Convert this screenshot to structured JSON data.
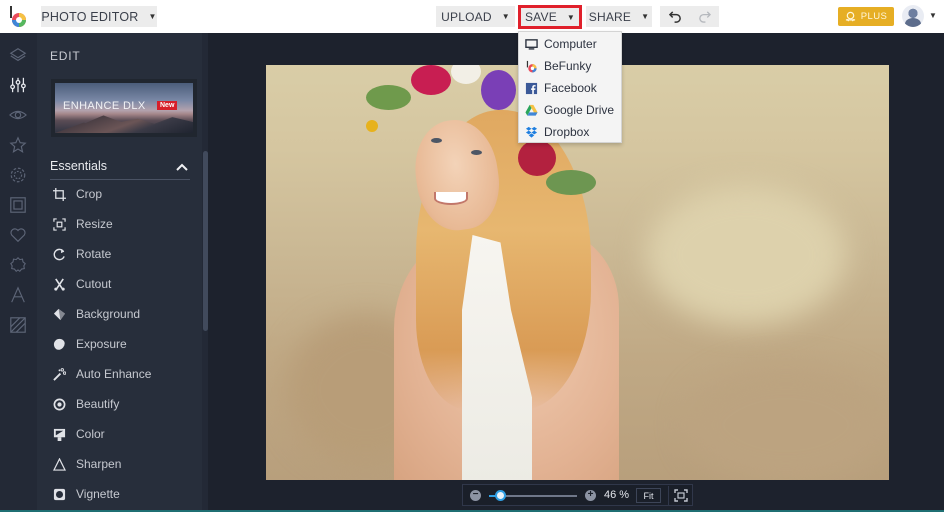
{
  "topbar": {
    "app_menu_label": "PHOTO EDITOR",
    "upload_label": "UPLOAD",
    "save_label": "SAVE",
    "share_label": "SHARE",
    "plus_label": "PLUS",
    "colors": {
      "save_highlight": "#e0202b",
      "plus_bg": "#e6ae24"
    }
  },
  "save_menu": {
    "items": [
      {
        "label": "Computer",
        "icon": "monitor-icon"
      },
      {
        "label": "BeFunky",
        "icon": "befunky-icon"
      },
      {
        "label": "Facebook",
        "icon": "facebook-icon"
      },
      {
        "label": "Google Drive",
        "icon": "google-drive-icon"
      },
      {
        "label": "Dropbox",
        "icon": "dropbox-icon"
      }
    ]
  },
  "rail": {
    "items": [
      {
        "icon": "layers-icon"
      },
      {
        "icon": "sliders-icon",
        "active": true
      },
      {
        "icon": "eye-icon"
      },
      {
        "icon": "star-icon"
      },
      {
        "icon": "gear-flower-icon"
      },
      {
        "icon": "frame-icon"
      },
      {
        "icon": "heart-icon"
      },
      {
        "icon": "badge-icon"
      },
      {
        "icon": "text-icon"
      },
      {
        "icon": "texture-icon"
      }
    ]
  },
  "panel": {
    "title": "EDIT",
    "banner": {
      "text": "ENHANCE DLX",
      "badge": "New"
    },
    "section": "Essentials",
    "tools": [
      {
        "label": "Crop",
        "icon": "crop-icon"
      },
      {
        "label": "Resize",
        "icon": "resize-icon"
      },
      {
        "label": "Rotate",
        "icon": "rotate-icon"
      },
      {
        "label": "Cutout",
        "icon": "cutout-icon"
      },
      {
        "label": "Background",
        "icon": "background-icon"
      },
      {
        "label": "Exposure",
        "icon": "exposure-icon"
      },
      {
        "label": "Auto Enhance",
        "icon": "magic-wand-icon"
      },
      {
        "label": "Beautify",
        "icon": "beautify-icon"
      },
      {
        "label": "Color",
        "icon": "color-icon"
      },
      {
        "label": "Sharpen",
        "icon": "sharpen-icon"
      },
      {
        "label": "Vignette",
        "icon": "vignette-icon"
      }
    ]
  },
  "zoom": {
    "percent_label": "46 %",
    "value": 46,
    "slider_fraction": 0.12,
    "fit_label": "Fit"
  }
}
